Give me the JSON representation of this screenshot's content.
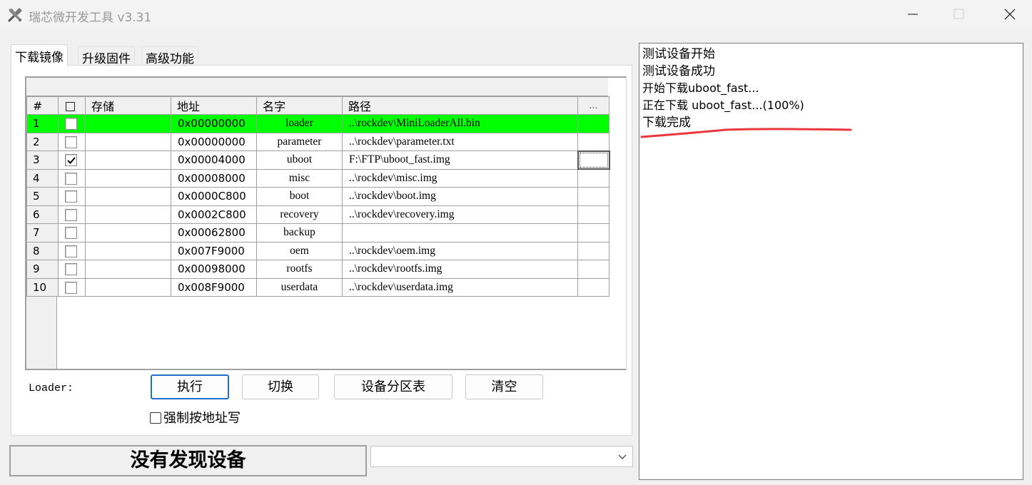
{
  "window": {
    "title": "瑞芯微开发工具 v3.31"
  },
  "tabs": [
    {
      "label": "下载镜像",
      "active": true
    },
    {
      "label": "升级固件",
      "active": false
    },
    {
      "label": "高级功能",
      "active": false
    }
  ],
  "table": {
    "headers": {
      "num": "#",
      "check": "",
      "storage": "存储",
      "address": "地址",
      "name": "名字",
      "path": "路径",
      "dots": "..."
    },
    "rows": [
      {
        "num": "1",
        "checked": false,
        "storage": "",
        "address": "0x00000000",
        "name": "loader",
        "path": "..\\rockdev\\MiniLoaderAll.bin",
        "highlight": true
      },
      {
        "num": "2",
        "checked": false,
        "storage": "",
        "address": "0x00000000",
        "name": "parameter",
        "path": "..\\rockdev\\parameter.txt",
        "highlight": false
      },
      {
        "num": "3",
        "checked": true,
        "storage": "",
        "address": "0x00004000",
        "name": "uboot",
        "path": "F:\\FTP\\uboot_fast.img",
        "highlight": false
      },
      {
        "num": "4",
        "checked": false,
        "storage": "",
        "address": "0x00008000",
        "name": "misc",
        "path": "..\\rockdev\\misc.img",
        "highlight": false
      },
      {
        "num": "5",
        "checked": false,
        "storage": "",
        "address": "0x0000C800",
        "name": "boot",
        "path": "..\\rockdev\\boot.img",
        "highlight": false
      },
      {
        "num": "6",
        "checked": false,
        "storage": "",
        "address": "0x0002C800",
        "name": "recovery",
        "path": "..\\rockdev\\recovery.img",
        "highlight": false
      },
      {
        "num": "7",
        "checked": false,
        "storage": "",
        "address": "0x00062800",
        "name": "backup",
        "path": "",
        "highlight": false
      },
      {
        "num": "8",
        "checked": false,
        "storage": "",
        "address": "0x007F9000",
        "name": "oem",
        "path": "..\\rockdev\\oem.img",
        "highlight": false
      },
      {
        "num": "9",
        "checked": false,
        "storage": "",
        "address": "0x00098000",
        "name": "rootfs",
        "path": "..\\rockdev\\rootfs.img",
        "highlight": false
      },
      {
        "num": "10",
        "checked": false,
        "storage": "",
        "address": "0x008F9000",
        "name": "userdata",
        "path": "..\\rockdev\\userdata.img",
        "highlight": false
      }
    ]
  },
  "controls": {
    "loader_label": "Loader:",
    "run_button": "执行",
    "switch_button": "切换",
    "partition_button": "设备分区表",
    "clear_button": "清空",
    "force_write_label": "强制按地址写"
  },
  "status": {
    "text": "没有发现设备",
    "combo_value": ""
  },
  "log": {
    "lines": [
      "测试设备开始",
      "测试设备成功",
      "开始下载uboot_fast...",
      "正在下载 uboot_fast...(100%)",
      "下载完成"
    ]
  },
  "colors": {
    "row_highlight": "#00ff00",
    "primary_button_border": "#1e6fc9",
    "annotation_red": "#e8383d"
  }
}
